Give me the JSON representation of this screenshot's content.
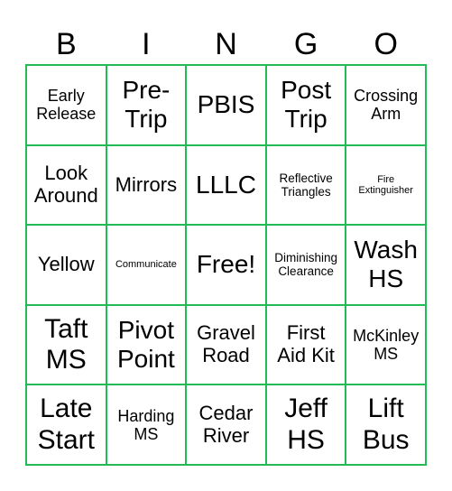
{
  "header": [
    "B",
    "I",
    "N",
    "G",
    "O"
  ],
  "colors": {
    "border": "#22bb55",
    "text": "#000000",
    "background": "#ffffff"
  },
  "cells": [
    [
      "Early\nRelease",
      "Pre-\nTrip",
      "PBIS",
      "Post\nTrip",
      "Crossing\nArm"
    ],
    [
      "Look\nAround",
      "Mirrors",
      "LLLC",
      "Reflective\nTriangles",
      "Fire\nExtinguisher"
    ],
    [
      "Yellow",
      "Communicate",
      "Free!",
      "Diminishing\nClearance",
      "Wash\nHS"
    ],
    [
      "Taft\nMS",
      "Pivot\nPoint",
      "Gravel\nRoad",
      "First\nAid Kit",
      "McKinley\nMS"
    ],
    [
      "Late\nStart",
      "Harding\nMS",
      "Cedar\nRiver",
      "Jeff\nHS",
      "Lift\nBus"
    ]
  ]
}
